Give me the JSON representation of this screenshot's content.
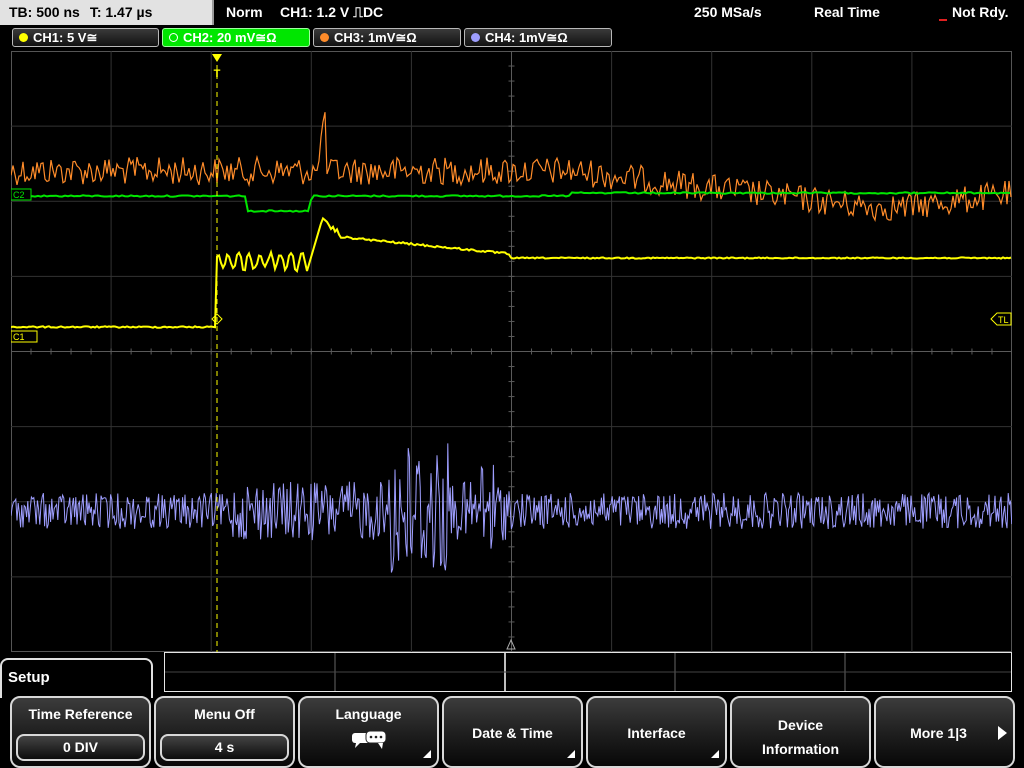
{
  "status": {
    "timebase": "TB: 500 ns",
    "trigger_time": "T: 1.47 µs",
    "mode": "Norm",
    "trigger_setting": "CH1: 1.2 V ⎍DC",
    "sample_rate": "250 MSa/s",
    "acq_mode": "Real Time",
    "ready": "Not Rdy."
  },
  "channels": [
    {
      "label": "CH1: 5 V≅",
      "color": "#ffff00",
      "active": false
    },
    {
      "label": "CH2: 20 mV≅Ω",
      "color": "#00e600",
      "active": true
    },
    {
      "label": "CH3: 1mV≅Ω",
      "color": "#ff8c2a",
      "active": false
    },
    {
      "label": "CH4: 1mV≅Ω",
      "color": "#9e9eff",
      "active": false
    }
  ],
  "markers": {
    "trigger": "T",
    "ch1": "C1",
    "ch2": "C2",
    "trigger_level": "TL"
  },
  "menu": {
    "title": "Setup",
    "softkeys": [
      {
        "label": "Time Reference",
        "value": "0 DIV"
      },
      {
        "label": "Menu Off",
        "value": "4 s"
      },
      {
        "label": "Language",
        "icon": "speech-bubbles-icon"
      },
      {
        "label": "Date & Time"
      },
      {
        "label": "Interface"
      },
      {
        "label": "Device Information"
      },
      {
        "label": "More 1|3",
        "icon": "right-arrow-icon"
      }
    ]
  }
}
